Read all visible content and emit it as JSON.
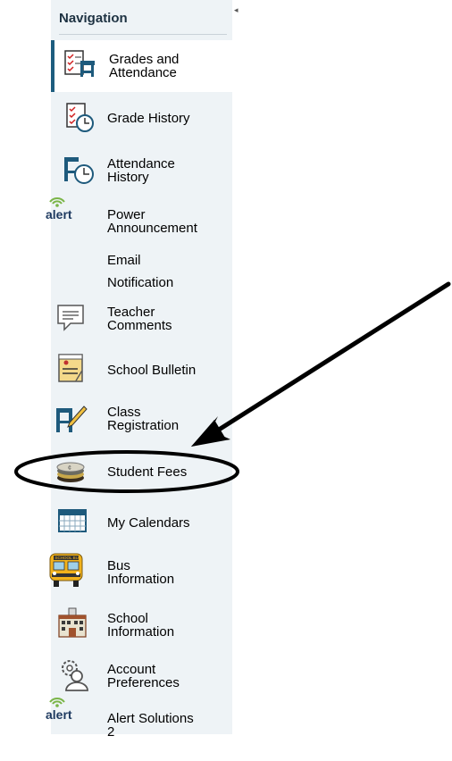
{
  "nav": {
    "title": "Navigation",
    "items": [
      {
        "label_line1": "Grades and",
        "label_line2": "Attendance",
        "icon": "grades-attendance-icon"
      },
      {
        "label_line1": "Grade History",
        "icon": "grade-history-icon"
      },
      {
        "label_line1": "Attendance",
        "label_line2": "History",
        "icon": "attendance-history-icon"
      },
      {
        "label_line1": "Power",
        "label_line2": "Announcement",
        "icon": "alert-icon",
        "icon_text": "alert"
      },
      {
        "label_line1": "Email",
        "label_line2": "Notification",
        "icon": "none"
      },
      {
        "label_line1": "Teacher",
        "label_line2": "Comments",
        "icon": "teacher-comments-icon"
      },
      {
        "label_line1": "School Bulletin",
        "icon": "school-bulletin-icon"
      },
      {
        "label_line1": "Class",
        "label_line2": "Registration",
        "icon": "class-registration-icon"
      },
      {
        "label_line1": "Student Fees",
        "icon": "student-fees-icon"
      },
      {
        "label_line1": "My Calendars",
        "icon": "calendar-icon"
      },
      {
        "label_line1": "Bus",
        "label_line2": "Information",
        "icon": "bus-icon",
        "icon_text": "SCHOOL BUS"
      },
      {
        "label_line1": "School",
        "label_line2": "Information",
        "icon": "school-building-icon"
      },
      {
        "label_line1": "Account",
        "label_line2": "Preferences",
        "icon": "account-preferences-icon"
      },
      {
        "label_line1": "Alert Solutions",
        "label_line2": "2",
        "icon": "alert-icon",
        "icon_text": "alert"
      }
    ]
  },
  "colors": {
    "sidebar_bg": "#eef3f6",
    "active_border": "#1d5d7f",
    "icon_blue": "#1e5a7c",
    "alert_green": "#7ab547"
  }
}
